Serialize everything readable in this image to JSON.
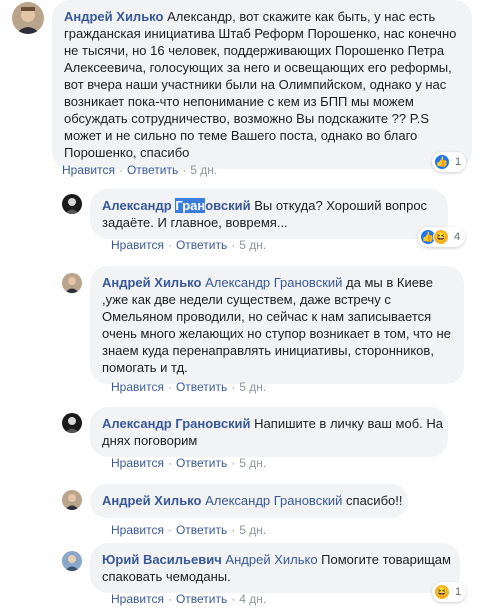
{
  "actions": {
    "like_label": "Нравится",
    "reply_label": "Ответить",
    "separator": "·"
  },
  "comments": [
    {
      "author": "Андрей Хилько",
      "lines": [
        "Александр, вот скажите как быть, у нас есть",
        "гражданская инициатива Штаб Реформ Порошенко, нас конечно",
        "не тысячи, но 16 человек, поддерживающих Порошенко Петра",
        "Алексеевича, голосующих за него и освещающих его реформы,",
        "вот вчера наши участники были на Олимпийском, однако у нас",
        "возникает пока-что непонимание с кем из БПП мы можем",
        "обсуждать сотрудничество, возможно Вы подскажите ?? P.S",
        "может и не сильно по теме Вашего поста, однако во благо",
        "Порошенко, спасибо"
      ],
      "time": "5 дн.",
      "reaction_count": "1",
      "reaction_icons": [
        "like-icon"
      ]
    },
    {
      "author_pre": "Александр ",
      "author_highlight": "Гран",
      "author_post": "овский",
      "text_first": "Вы откуда? Хороший вопрос",
      "lines": [
        "задаёте. И главное, вовремя..."
      ],
      "time": "5 дн.",
      "reaction_count": "4",
      "reaction_icons": [
        "like-icon",
        "haha-icon"
      ]
    },
    {
      "author": "Андрей Хилько",
      "mention": "Александр Грановский",
      "text_first": "да мы в Киеве",
      "lines": [
        ",уже как две недели существем, даже встречу с",
        "Омельяном проводили, но сейчас к нам записывается",
        "очень много желающих но ступор возникает в том, что не",
        "знаем куда перенаправлять инициативы, сторонников,",
        "помогать и тд."
      ],
      "time": "5 дн."
    },
    {
      "author": "Александр Грановский",
      "text_first": "Напишите в личку ваш моб. На",
      "lines": [
        "днях поговорим"
      ],
      "time": "5 дн."
    },
    {
      "author": "Андрей Хилько",
      "mention": "Александр Грановский",
      "text_first": "спасибо!!",
      "time": "5 дн."
    },
    {
      "author": "Юрий Васильевич",
      "mention": "Андрей Хилько",
      "text_first": "Помогите товарищам",
      "lines": [
        "спаковать чемоданы."
      ],
      "time": "4 дн.",
      "reaction_count": "1",
      "reaction_icons": [
        "haha-icon"
      ]
    }
  ]
}
